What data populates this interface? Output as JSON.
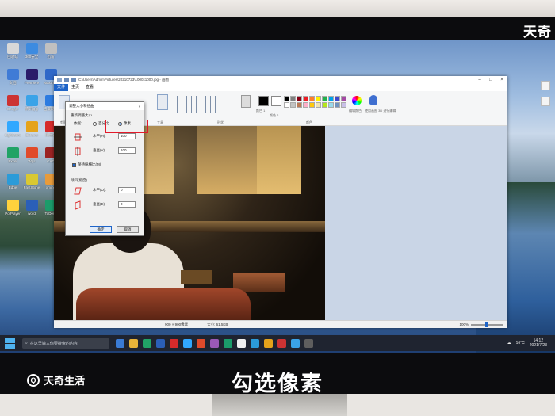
{
  "watermark": "天奇",
  "desktop_icons": [
    {
      "label": "回收站",
      "color": "#d8d8d8"
    },
    {
      "label": "360安全",
      "color": "#3d8be0"
    },
    {
      "label": "迅雷",
      "color": "#c0c0c0"
    },
    {
      "label": "文档",
      "color": "#3f7bd6"
    },
    {
      "label": "Premiere",
      "color": "#2a1b6a"
    },
    {
      "label": "Maxthon",
      "color": "#2f68c8"
    },
    {
      "label": "Google",
      "color": "#cc3333"
    },
    {
      "label": "腾讯QQ",
      "color": "#3aa3e8"
    },
    {
      "label": "百度网盘",
      "color": "#2c7be0"
    },
    {
      "label": "Lightroom",
      "color": "#31a8ff"
    },
    {
      "label": "Chrome",
      "color": "#e5a31b"
    },
    {
      "label": "网易云",
      "color": "#d62b2b"
    },
    {
      "label": "Excel",
      "color": "#21a366"
    },
    {
      "label": "Wps",
      "color": "#e04b2b"
    },
    {
      "label": "CAD",
      "color": "#9b2323"
    },
    {
      "label": "Edge",
      "color": "#2b9bd8"
    },
    {
      "label": "FastStone",
      "color": "#d9c832"
    },
    {
      "label": "xmind",
      "color": "#e89b3b"
    },
    {
      "label": "PotPlayer",
      "color": "#ffd23d"
    },
    {
      "label": "word",
      "color": "#2b5fb8"
    },
    {
      "label": "ToDesk",
      "color": "#1b9c6a"
    }
  ],
  "paint": {
    "title": "C:\\Users\\Admin\\Pictures\\20210723\\1000x1000.jpg - 画图",
    "tabs": [
      "文件",
      "主页",
      "查看"
    ],
    "groups": [
      "剪贴板",
      "图像",
      "工具",
      "形状",
      "颜色"
    ],
    "color1_label": "颜色 1",
    "color2_label": "颜色 2",
    "edit_colors_label": "编辑颜色",
    "paint3d_label": "使用画图 3D 进行编辑",
    "palette": [
      "#000000",
      "#7f7f7f",
      "#880015",
      "#ed1c24",
      "#ff7f27",
      "#fff200",
      "#22b14c",
      "#00a2e8",
      "#3f48cc",
      "#a349a4",
      "#ffffff",
      "#c3c3c3",
      "#b97a57",
      "#ffaec9",
      "#ffc90e",
      "#efe4b0",
      "#b5e61d",
      "#99d9ea",
      "#7092be",
      "#c8bfe7"
    ],
    "status_size": "900 × 900像素",
    "status_file": "大小: 61.5KB",
    "zoom": "100%"
  },
  "dialog": {
    "title": "调整大小和扭曲",
    "resize_section": "重新调整大小",
    "by_label": "依据:",
    "percent_label": "百分比",
    "pixels_label": "像素",
    "h_label": "水平(H):",
    "v_label": "垂直(V):",
    "h_value": "100",
    "v_value": "100",
    "keep_ratio": "保持纵横比(M)",
    "skew_section": "倾斜(角度)",
    "skew_h_label": "水平(O):",
    "skew_v_label": "垂直(E):",
    "skew_h_value": "0",
    "skew_v_value": "0",
    "ok": "确定",
    "cancel": "取消",
    "close": "×"
  },
  "taskbar": {
    "search_placeholder": "在这里输入你要搜索的内容",
    "temp": "16°C",
    "time": "14:12",
    "date": "2021/7/23"
  },
  "brand": "天奇生活",
  "caption": "勾选像素"
}
